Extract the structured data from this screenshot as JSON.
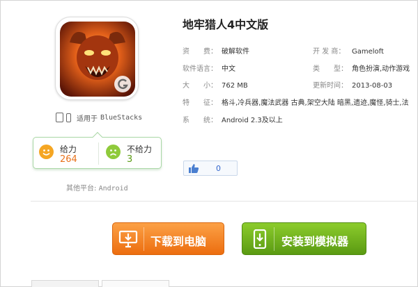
{
  "app": {
    "title": "地牢猎人4中文版",
    "icon": "dungeon-hunter-4-app-icon",
    "watermark_icon": "gameloft-g-logo"
  },
  "compatibility": {
    "devices_icons": [
      "tablet-icon",
      "phone-icon"
    ],
    "label": "适用于",
    "platform": "BlueStacks"
  },
  "rating": {
    "good_label": "给力",
    "good_count": "264",
    "bad_label": "不给力",
    "bad_count": "3",
    "colors": {
      "good": "#f5a623",
      "bad": "#8fca3b",
      "count_good": "#e8711a",
      "count_bad": "#5a9a12"
    }
  },
  "other_platform": {
    "label": "其他平台:",
    "value": "Android"
  },
  "info": {
    "left": [
      {
        "label": "资　　费：",
        "value": "破解软件"
      },
      {
        "label": "软件语言：",
        "value": "中文"
      },
      {
        "label": "大　　小：",
        "value": "762 MB"
      },
      {
        "label": "特　　征：",
        "value": "格斗,冷兵器,魔法武器 古典,架空大陆 暗黑,遗迹,魔怪,骑士,法"
      },
      {
        "label": "系　　统：",
        "value": "Android 2.3及以上"
      }
    ],
    "right": [
      {
        "label": "开 发 商：",
        "value": "Gameloft"
      },
      {
        "label": "类　　型：",
        "value": "角色扮演,动作游戏"
      },
      {
        "label": "更新时间：",
        "value": "2013-08-03"
      }
    ]
  },
  "like": {
    "icon": "thumbs-up-icon",
    "count": "0"
  },
  "buttons": {
    "download": {
      "label": "下载到电脑",
      "icon": "monitor-download-icon",
      "color": "#f08a2a"
    },
    "install": {
      "label": "安装到模拟器",
      "icon": "phone-install-icon",
      "color": "#6fb11c"
    }
  }
}
